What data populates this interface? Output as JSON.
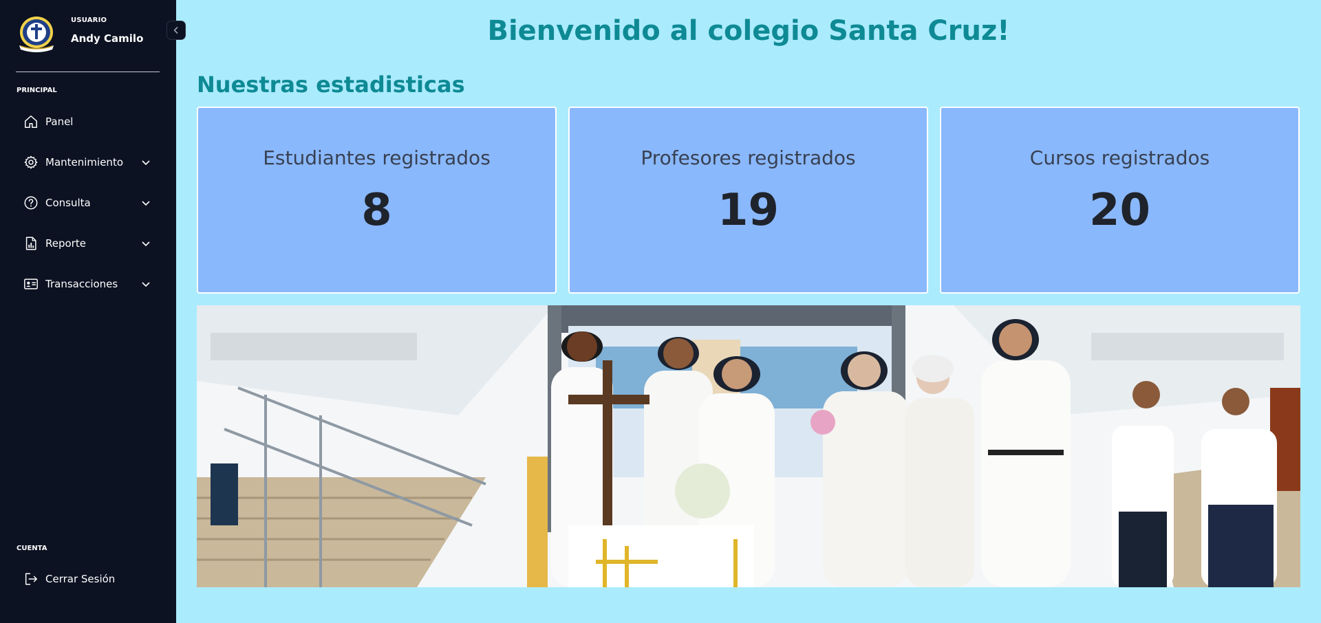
{
  "sidebar": {
    "user": {
      "role_label": "USUARIO",
      "name": "Andy Camilo"
    },
    "sections": {
      "main": "PRINCIPAL",
      "account": "CUENTA"
    },
    "items": [
      {
        "label": "Panel",
        "icon": "home-icon"
      },
      {
        "label": "Mantenimiento",
        "icon": "gear-icon"
      },
      {
        "label": "Consulta",
        "icon": "help-circle-icon"
      },
      {
        "label": "Reporte",
        "icon": "report-icon"
      },
      {
        "label": "Transacciones",
        "icon": "id-card-icon"
      }
    ],
    "logout": {
      "label": "Cerrar Sesión",
      "icon": "logout-icon"
    }
  },
  "main": {
    "title": "Bienvenido al colegio Santa Cruz!",
    "stats_title": "Nuestras estadisticas",
    "stats": [
      {
        "label": "Estudiantes registrados",
        "value": "8"
      },
      {
        "label": "Profesores registrados",
        "value": "19"
      },
      {
        "label": "Cursos registrados",
        "value": "20"
      }
    ]
  },
  "colors": {
    "sidebar_bg": "#0c1222",
    "page_bg": "#abebfe",
    "accent": "#0e8a94",
    "card_bg": "#8ab8fd"
  }
}
